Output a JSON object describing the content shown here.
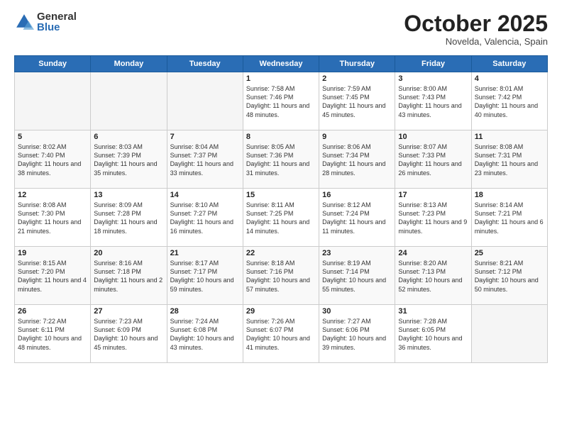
{
  "logo": {
    "general": "General",
    "blue": "Blue"
  },
  "header": {
    "month": "October 2025",
    "location": "Novelda, Valencia, Spain"
  },
  "weekdays": [
    "Sunday",
    "Monday",
    "Tuesday",
    "Wednesday",
    "Thursday",
    "Friday",
    "Saturday"
  ],
  "weeks": [
    [
      {
        "day": "",
        "sunrise": "",
        "sunset": "",
        "daylight": "",
        "empty": true
      },
      {
        "day": "",
        "sunrise": "",
        "sunset": "",
        "daylight": "",
        "empty": true
      },
      {
        "day": "",
        "sunrise": "",
        "sunset": "",
        "daylight": "",
        "empty": true
      },
      {
        "day": "1",
        "sunrise": "Sunrise: 7:58 AM",
        "sunset": "Sunset: 7:46 PM",
        "daylight": "Daylight: 11 hours and 48 minutes.",
        "empty": false
      },
      {
        "day": "2",
        "sunrise": "Sunrise: 7:59 AM",
        "sunset": "Sunset: 7:45 PM",
        "daylight": "Daylight: 11 hours and 45 minutes.",
        "empty": false
      },
      {
        "day": "3",
        "sunrise": "Sunrise: 8:00 AM",
        "sunset": "Sunset: 7:43 PM",
        "daylight": "Daylight: 11 hours and 43 minutes.",
        "empty": false
      },
      {
        "day": "4",
        "sunrise": "Sunrise: 8:01 AM",
        "sunset": "Sunset: 7:42 PM",
        "daylight": "Daylight: 11 hours and 40 minutes.",
        "empty": false
      }
    ],
    [
      {
        "day": "5",
        "sunrise": "Sunrise: 8:02 AM",
        "sunset": "Sunset: 7:40 PM",
        "daylight": "Daylight: 11 hours and 38 minutes.",
        "empty": false
      },
      {
        "day": "6",
        "sunrise": "Sunrise: 8:03 AM",
        "sunset": "Sunset: 7:39 PM",
        "daylight": "Daylight: 11 hours and 35 minutes.",
        "empty": false
      },
      {
        "day": "7",
        "sunrise": "Sunrise: 8:04 AM",
        "sunset": "Sunset: 7:37 PM",
        "daylight": "Daylight: 11 hours and 33 minutes.",
        "empty": false
      },
      {
        "day": "8",
        "sunrise": "Sunrise: 8:05 AM",
        "sunset": "Sunset: 7:36 PM",
        "daylight": "Daylight: 11 hours and 31 minutes.",
        "empty": false
      },
      {
        "day": "9",
        "sunrise": "Sunrise: 8:06 AM",
        "sunset": "Sunset: 7:34 PM",
        "daylight": "Daylight: 11 hours and 28 minutes.",
        "empty": false
      },
      {
        "day": "10",
        "sunrise": "Sunrise: 8:07 AM",
        "sunset": "Sunset: 7:33 PM",
        "daylight": "Daylight: 11 hours and 26 minutes.",
        "empty": false
      },
      {
        "day": "11",
        "sunrise": "Sunrise: 8:08 AM",
        "sunset": "Sunset: 7:31 PM",
        "daylight": "Daylight: 11 hours and 23 minutes.",
        "empty": false
      }
    ],
    [
      {
        "day": "12",
        "sunrise": "Sunrise: 8:08 AM",
        "sunset": "Sunset: 7:30 PM",
        "daylight": "Daylight: 11 hours and 21 minutes.",
        "empty": false
      },
      {
        "day": "13",
        "sunrise": "Sunrise: 8:09 AM",
        "sunset": "Sunset: 7:28 PM",
        "daylight": "Daylight: 11 hours and 18 minutes.",
        "empty": false
      },
      {
        "day": "14",
        "sunrise": "Sunrise: 8:10 AM",
        "sunset": "Sunset: 7:27 PM",
        "daylight": "Daylight: 11 hours and 16 minutes.",
        "empty": false
      },
      {
        "day": "15",
        "sunrise": "Sunrise: 8:11 AM",
        "sunset": "Sunset: 7:25 PM",
        "daylight": "Daylight: 11 hours and 14 minutes.",
        "empty": false
      },
      {
        "day": "16",
        "sunrise": "Sunrise: 8:12 AM",
        "sunset": "Sunset: 7:24 PM",
        "daylight": "Daylight: 11 hours and 11 minutes.",
        "empty": false
      },
      {
        "day": "17",
        "sunrise": "Sunrise: 8:13 AM",
        "sunset": "Sunset: 7:23 PM",
        "daylight": "Daylight: 11 hours and 9 minutes.",
        "empty": false
      },
      {
        "day": "18",
        "sunrise": "Sunrise: 8:14 AM",
        "sunset": "Sunset: 7:21 PM",
        "daylight": "Daylight: 11 hours and 6 minutes.",
        "empty": false
      }
    ],
    [
      {
        "day": "19",
        "sunrise": "Sunrise: 8:15 AM",
        "sunset": "Sunset: 7:20 PM",
        "daylight": "Daylight: 11 hours and 4 minutes.",
        "empty": false
      },
      {
        "day": "20",
        "sunrise": "Sunrise: 8:16 AM",
        "sunset": "Sunset: 7:18 PM",
        "daylight": "Daylight: 11 hours and 2 minutes.",
        "empty": false
      },
      {
        "day": "21",
        "sunrise": "Sunrise: 8:17 AM",
        "sunset": "Sunset: 7:17 PM",
        "daylight": "Daylight: 10 hours and 59 minutes.",
        "empty": false
      },
      {
        "day": "22",
        "sunrise": "Sunrise: 8:18 AM",
        "sunset": "Sunset: 7:16 PM",
        "daylight": "Daylight: 10 hours and 57 minutes.",
        "empty": false
      },
      {
        "day": "23",
        "sunrise": "Sunrise: 8:19 AM",
        "sunset": "Sunset: 7:14 PM",
        "daylight": "Daylight: 10 hours and 55 minutes.",
        "empty": false
      },
      {
        "day": "24",
        "sunrise": "Sunrise: 8:20 AM",
        "sunset": "Sunset: 7:13 PM",
        "daylight": "Daylight: 10 hours and 52 minutes.",
        "empty": false
      },
      {
        "day": "25",
        "sunrise": "Sunrise: 8:21 AM",
        "sunset": "Sunset: 7:12 PM",
        "daylight": "Daylight: 10 hours and 50 minutes.",
        "empty": false
      }
    ],
    [
      {
        "day": "26",
        "sunrise": "Sunrise: 7:22 AM",
        "sunset": "Sunset: 6:11 PM",
        "daylight": "Daylight: 10 hours and 48 minutes.",
        "empty": false
      },
      {
        "day": "27",
        "sunrise": "Sunrise: 7:23 AM",
        "sunset": "Sunset: 6:09 PM",
        "daylight": "Daylight: 10 hours and 45 minutes.",
        "empty": false
      },
      {
        "day": "28",
        "sunrise": "Sunrise: 7:24 AM",
        "sunset": "Sunset: 6:08 PM",
        "daylight": "Daylight: 10 hours and 43 minutes.",
        "empty": false
      },
      {
        "day": "29",
        "sunrise": "Sunrise: 7:26 AM",
        "sunset": "Sunset: 6:07 PM",
        "daylight": "Daylight: 10 hours and 41 minutes.",
        "empty": false
      },
      {
        "day": "30",
        "sunrise": "Sunrise: 7:27 AM",
        "sunset": "Sunset: 6:06 PM",
        "daylight": "Daylight: 10 hours and 39 minutes.",
        "empty": false
      },
      {
        "day": "31",
        "sunrise": "Sunrise: 7:28 AM",
        "sunset": "Sunset: 6:05 PM",
        "daylight": "Daylight: 10 hours and 36 minutes.",
        "empty": false
      },
      {
        "day": "",
        "sunrise": "",
        "sunset": "",
        "daylight": "",
        "empty": true
      }
    ]
  ]
}
